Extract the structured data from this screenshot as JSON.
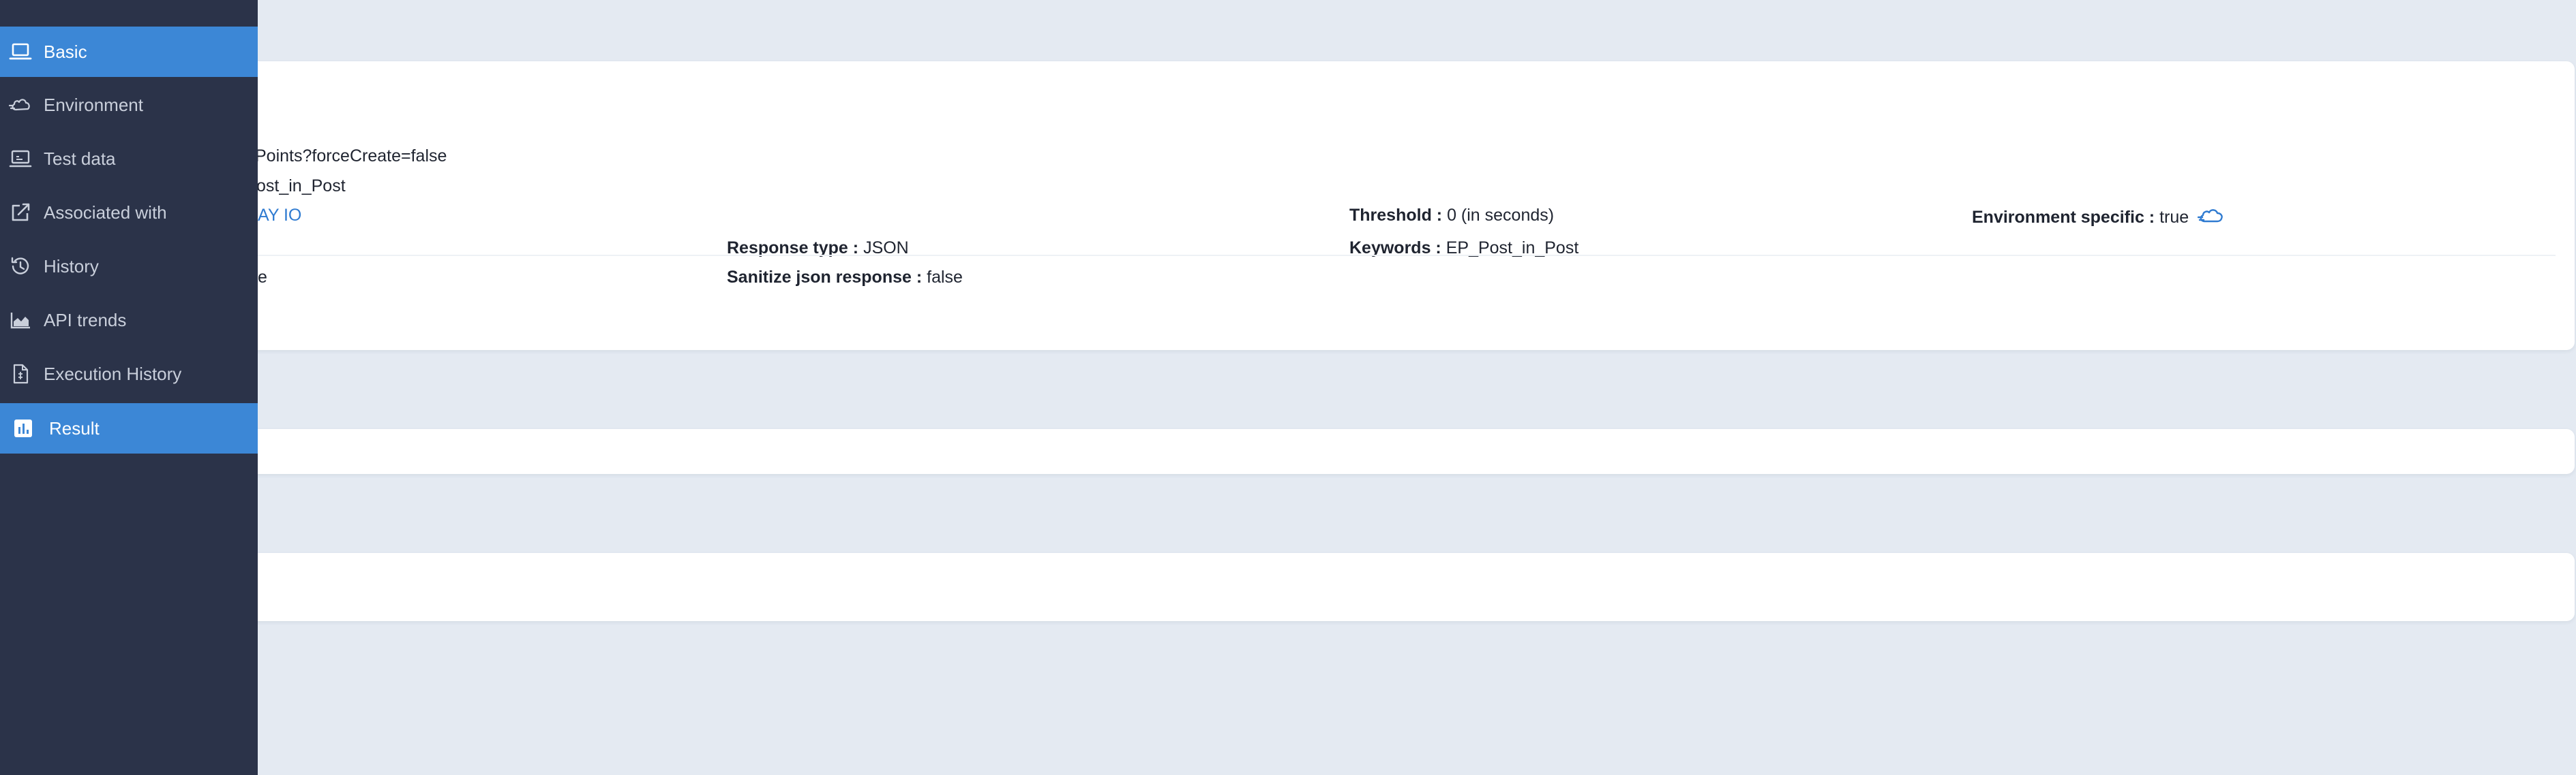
{
  "sidebar": {
    "items": [
      {
        "label": "Basic",
        "icon": "laptop-icon",
        "active": true
      },
      {
        "label": "Environment",
        "icon": "cloud-icon",
        "active": false
      },
      {
        "label": "Test data",
        "icon": "laptop-icon",
        "active": false
      },
      {
        "label": "Associated with",
        "icon": "external-link-icon",
        "active": false
      },
      {
        "label": "History",
        "icon": "history-icon",
        "active": false
      },
      {
        "label": "API trends",
        "icon": "area-chart-icon",
        "active": false
      },
      {
        "label": "Execution History",
        "icon": "document-icon",
        "active": false
      },
      {
        "label": "Result",
        "icon": "bar-chart-icon",
        "active": true
      }
    ]
  },
  "basic": {
    "url_fragment": "Points?forceCreate=false",
    "name_fragment": "ost_in_Post",
    "link_fragment": "AY IO",
    "misc_fragment": "e",
    "response_type": {
      "label": "Response type :",
      "value": "JSON"
    },
    "sanitize": {
      "label": "Sanitize json response :",
      "value": "false"
    },
    "threshold": {
      "label": "Threshold :",
      "value": "0 (in seconds)"
    },
    "keywords": {
      "label": "Keywords :",
      "value": "EP_Post_in_Post"
    },
    "env_specific": {
      "label": "Environment specific :",
      "value": "true"
    }
  },
  "colors": {
    "page_bg": "#e4eaf2",
    "sidebar_bg": "#2b3349",
    "active_bg": "#3c87d6",
    "link": "#2f7bd1"
  }
}
